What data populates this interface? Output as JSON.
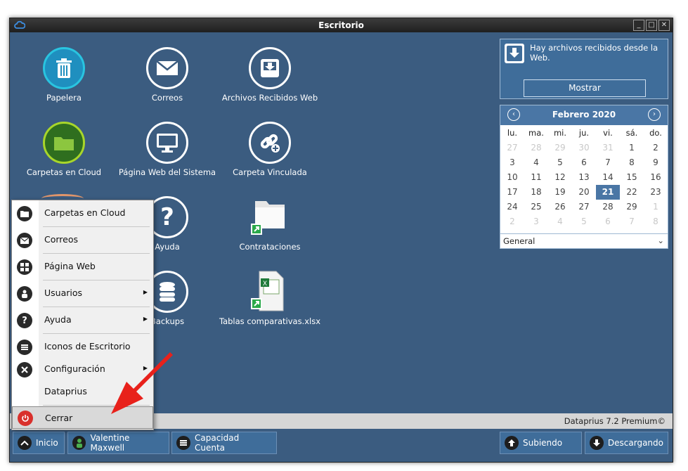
{
  "window": {
    "title": "Escritorio",
    "buttons": [
      "_",
      "□",
      "✕"
    ]
  },
  "desktop": {
    "icons": [
      {
        "label": "Papelera",
        "icon": "trash-icon"
      },
      {
        "label": "Correos",
        "icon": "mail-icon"
      },
      {
        "label": "Archivos Recibidos Web",
        "icon": "inbox-icon"
      },
      {
        "label": "Carpetas en Cloud",
        "icon": "folder-icon"
      },
      {
        "label": "Página Web del Sistema",
        "icon": "monitor-icon"
      },
      {
        "label": "Carpeta Vinculada",
        "icon": "link-icon"
      },
      {
        "label": "Ayuda",
        "icon": "help-icon"
      },
      {
        "label": "Contrataciones",
        "icon": "folder-shortcut-icon"
      },
      {
        "label": "Backups",
        "icon": "database-icon"
      },
      {
        "label": "Tablas comparativas.xlsx",
        "icon": "excel-file-icon"
      }
    ]
  },
  "notification": {
    "text": "Hay archivos recibidos desde la Web.",
    "button": "Mostrar"
  },
  "calendar": {
    "month": "Febrero 2020",
    "prev": "‹",
    "next": "›",
    "weekdays": [
      "lu.",
      "ma.",
      "mi.",
      "ju.",
      "vi.",
      "sá.",
      "do."
    ],
    "days": [
      {
        "d": "27",
        "o": true
      },
      {
        "d": "28",
        "o": true
      },
      {
        "d": "29",
        "o": true
      },
      {
        "d": "30",
        "o": true
      },
      {
        "d": "31",
        "o": true
      },
      {
        "d": "1"
      },
      {
        "d": "2"
      },
      {
        "d": "3"
      },
      {
        "d": "4"
      },
      {
        "d": "5"
      },
      {
        "d": "6"
      },
      {
        "d": "7"
      },
      {
        "d": "8"
      },
      {
        "d": "9"
      },
      {
        "d": "10"
      },
      {
        "d": "11"
      },
      {
        "d": "12"
      },
      {
        "d": "13"
      },
      {
        "d": "14"
      },
      {
        "d": "15"
      },
      {
        "d": "16"
      },
      {
        "d": "17"
      },
      {
        "d": "18"
      },
      {
        "d": "19"
      },
      {
        "d": "20"
      },
      {
        "d": "21",
        "s": true
      },
      {
        "d": "22"
      },
      {
        "d": "23"
      },
      {
        "d": "24"
      },
      {
        "d": "25"
      },
      {
        "d": "26"
      },
      {
        "d": "27"
      },
      {
        "d": "28"
      },
      {
        "d": "29"
      },
      {
        "d": "1",
        "o": true
      },
      {
        "d": "2",
        "o": true
      },
      {
        "d": "3",
        "o": true
      },
      {
        "d": "4",
        "o": true
      },
      {
        "d": "5",
        "o": true
      },
      {
        "d": "6",
        "o": true
      },
      {
        "d": "7",
        "o": true
      },
      {
        "d": "8",
        "o": true
      }
    ],
    "selected_day": "21",
    "select_value": "General"
  },
  "status": {
    "version": "Dataprius 7.2 Premium©"
  },
  "menu": {
    "items": [
      {
        "label": "Carpetas en Cloud",
        "icon": "folder-icon"
      },
      {
        "label": "Correos",
        "icon": "mail-icon"
      },
      {
        "label": "Página Web",
        "icon": "grid-icon"
      },
      {
        "label": "Usuarios",
        "icon": "user-icon",
        "submenu": true
      },
      {
        "label": "Ayuda",
        "icon": "help-icon",
        "submenu": true
      },
      {
        "label": "Iconos de Escritorio",
        "icon": "list-icon"
      },
      {
        "label": "Configuración",
        "icon": "tools-icon",
        "submenu": true
      },
      {
        "label": "Dataprius",
        "icon": ""
      },
      {
        "label": "Cerrar",
        "icon": "power-icon",
        "highlighted": true
      }
    ],
    "submenu_arrow": "▶"
  },
  "taskbar": {
    "start": "Inicio",
    "user": "Valentine Maxwell",
    "capacity": "Capacidad Cuenta",
    "uploading": "Subiendo",
    "downloading": "Descargando"
  },
  "colors": {
    "desktop": "#3b5c80",
    "accent": "#4a76a5",
    "trash_ring": "#29c4e0",
    "folder_ring": "#a8d62a",
    "arrow": "#e8211b"
  }
}
